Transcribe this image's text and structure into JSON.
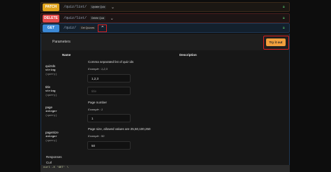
{
  "operations": [
    {
      "method": "PATCH",
      "path": "/quiz/list/",
      "summary": "Update Quiz"
    },
    {
      "method": "DELETE",
      "path": "/quiz/list/",
      "summary": "Delete Quiz"
    },
    {
      "method": "GET",
      "path": "/quiz/",
      "summary": "Get Quizzes"
    }
  ],
  "panel": {
    "title": "Parameters",
    "try_label": "Try it out",
    "col_name": "Name",
    "col_description": "Description"
  },
  "params": [
    {
      "name": "quizIds",
      "type": "string",
      "location": "(query)",
      "description": "Comma separated list of quiz ids",
      "example": "Example : 1,2,3",
      "value": "1,2,3",
      "placeholder": ""
    },
    {
      "name": "title",
      "type": "string",
      "location": "(query)",
      "description": "",
      "example": "",
      "value": "",
      "placeholder": "title"
    },
    {
      "name": "page",
      "type": "integer",
      "location": "(query)",
      "description": "Page number",
      "example": "Example : 1",
      "value": "1",
      "placeholder": ""
    },
    {
      "name": "pageSize",
      "type": "integer",
      "location": "(query)",
      "description": "Page size, allowed values are 25,50,100,250",
      "example": "Example : 50",
      "value": "50",
      "placeholder": ""
    }
  ],
  "responses_label": "Responses",
  "curl_label": "Curl",
  "curl_code": "curl -X 'GET' \\"
}
